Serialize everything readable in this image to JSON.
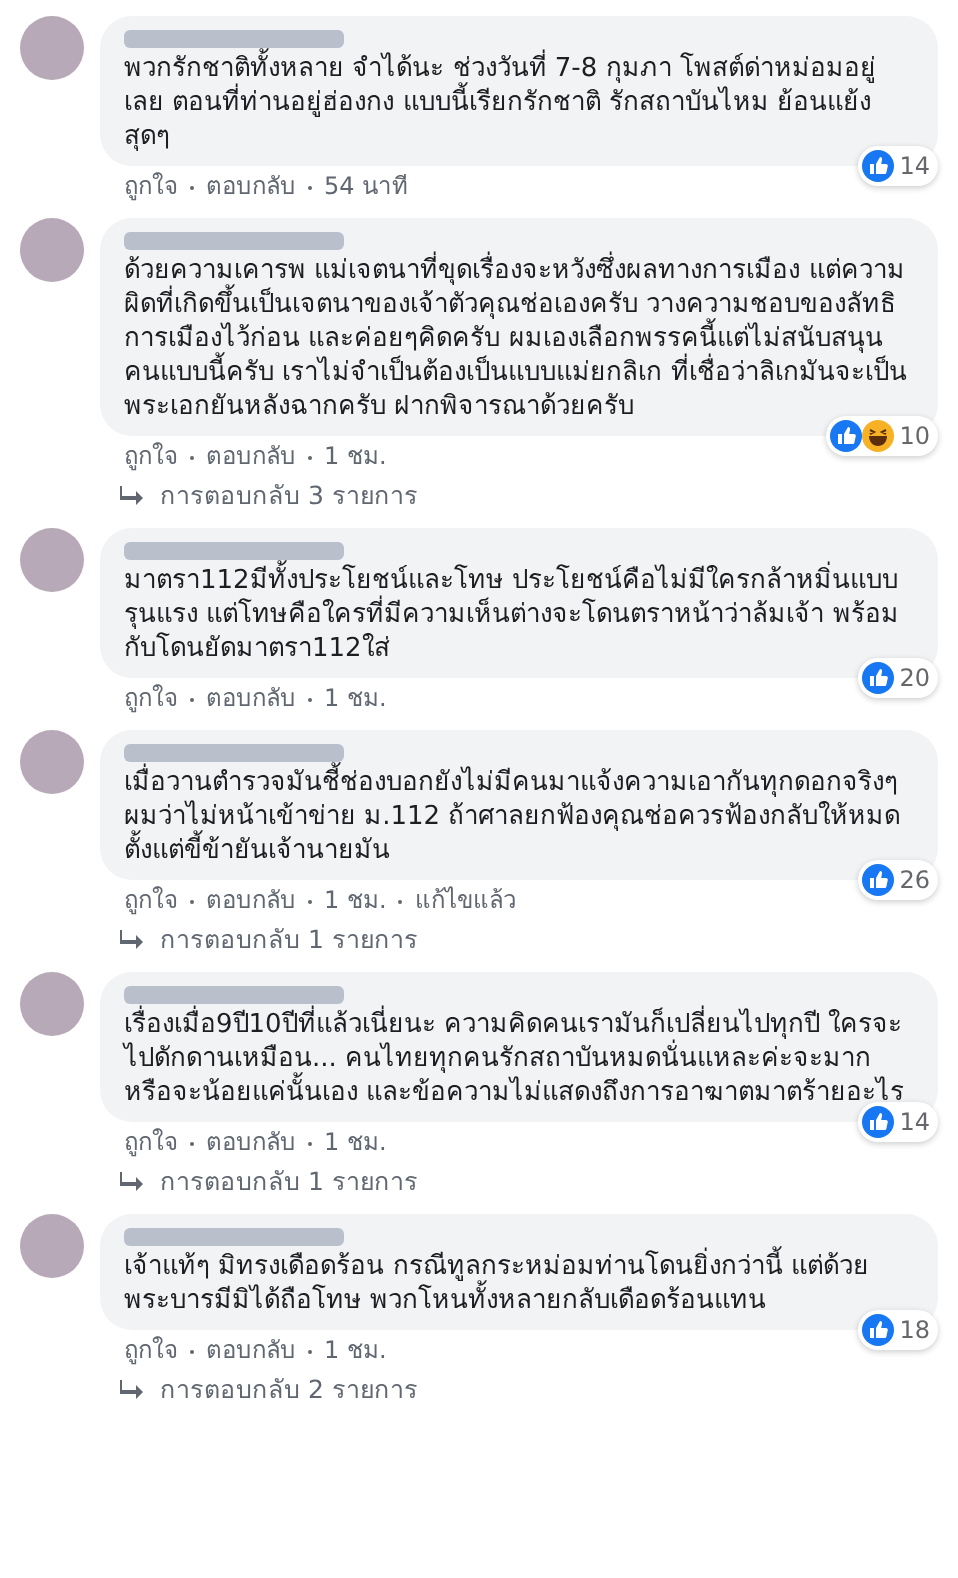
{
  "comments": [
    {
      "text": "พวกรักชาติทั้งหลาย จำได้นะ ช่วงวันที่ 7-8 กุมภา โพสต์ด่าหม่อมอยู่เลย ตอนที่ท่านอยู่ฮ่องกง แบบนี้เรียกรักชาติ รักสถาบันไหม ย้อนแย้งสุดๆ",
      "reactions": [
        {
          "kind": "like"
        }
      ],
      "count": "14",
      "actions": [
        "ถูกใจ",
        "ตอบกลับ",
        "54 นาที"
      ]
    },
    {
      "text": "ด้วยความเคารพ แม่เจตนาที่ขุดเรื่องจะหวังซึ่งผลทางการเมือง แต่ความผิดที่เกิดขึ้นเป็นเจตนาของเจ้าตัวคุณช่อเองครับ วางความชอบของลัทธิการเมืองไว้ก่อน และค่อยๆคิดครับ ผมเองเลือกพรรคนี้แต่ไม่สนับสนุนคนแบบนี้ครับ เราไม่จำเป็นต้องเป็นแบบแม่ยกลิเก ที่เชื่อว่าลิเกมันจะเป็นพระเอกยันหลังฉากครับ ฝากพิจารณาด้วยครับ",
      "reactions": [
        {
          "kind": "like"
        },
        {
          "kind": "haha"
        }
      ],
      "count": "10",
      "actions": [
        "ถูกใจ",
        "ตอบกลับ",
        "1 ชม."
      ],
      "replies": "การตอบกลับ 3 รายการ"
    },
    {
      "text": "มาตรา112มีทั้งประโยชน์และโทษ ประโยชน์คือไม่มีใครกล้าหมิ่นแบบรุนแรง แต่โทษคือใครที่มีความเห็นต่างจะโดนตราหน้าว่าล้มเจ้า พร้อมกับโดนยัดมาตรา112ใส่",
      "reactions": [
        {
          "kind": "like"
        }
      ],
      "count": "20",
      "actions": [
        "ถูกใจ",
        "ตอบกลับ",
        "1 ชม."
      ]
    },
    {
      "text": "เมื่อวานตำรวจมันชี้ช่องบอกยังไม่มีคนมาแจ้งความเอากันทุกดอกจริงๆ ผมว่าไม่หน้าเข้าข่าย ม.112 ถ้าศาลยกฟ้องคุณช่อควรฟ้องกลับให้หมดตั้งแต่ขี้ข้ายันเจ้านายมัน",
      "reactions": [
        {
          "kind": "like"
        }
      ],
      "count": "26",
      "actions": [
        "ถูกใจ",
        "ตอบกลับ",
        "1 ชม.",
        "แก้ไขแล้ว"
      ],
      "replies": "การตอบกลับ 1 รายการ"
    },
    {
      "text": "เรื่องเมื่อ9ปี10ปีที่แล้วเนี่ยนะ ความคิดคนเรามันก็เปลี่ยนไปทุกปี ใครจะไปดักดานเหมือน... คนไทยทุกคนรักสถาบันหมดนั่นแหละค่ะจะมากหรือจะน้อยแค่นั้นเอง และข้อความไม่แสดงถึงการอาฆาตมาตร้ายอะไร",
      "reactions": [
        {
          "kind": "like"
        }
      ],
      "count": "14",
      "actions": [
        "ถูกใจ",
        "ตอบกลับ",
        "1 ชม."
      ],
      "replies": "การตอบกลับ 1 รายการ"
    },
    {
      "text": "เจ้าแท้ๆ มิทรงเดือดร้อน กรณีทูลกระหม่อมท่านโดนยิ่งกว่านี้ แต่ด้วยพระบารมีมิได้ถือโทษ พวกโหนทั้งหลายกลับเดือดร้อนแทน",
      "reactions": [
        {
          "kind": "like"
        }
      ],
      "count": "18",
      "actions": [
        "ถูกใจ",
        "ตอบกลับ",
        "1 ชม."
      ],
      "replies": "การตอบกลับ 2 รายการ"
    }
  ]
}
